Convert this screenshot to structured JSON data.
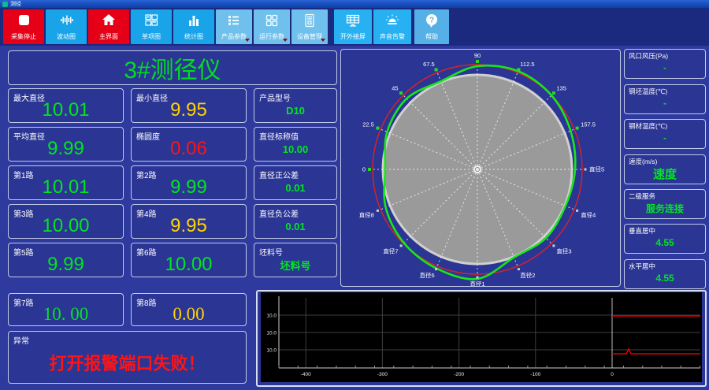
{
  "window": {
    "title": "测径"
  },
  "colors": {
    "value_green": "#00e61e",
    "value_yellow": "#ffd400",
    "value_red": "#ff1414",
    "button_red": "#e60017",
    "button_cyan": "#19a3e8",
    "button_light": "#6fc0ec",
    "tolerance_circle": "#dd2222",
    "profile_curve": "#19e619"
  },
  "toolbar": {
    "buttons": [
      {
        "label": "采集停止",
        "icon": "stop-icon",
        "style": "red",
        "dropdown": false
      },
      {
        "label": "波动图",
        "icon": "waveform-icon",
        "style": "cyan",
        "dropdown": false
      },
      {
        "label": "主界面",
        "icon": "home-icon",
        "style": "red",
        "dropdown": false
      },
      {
        "label": "单项图",
        "icon": "multi-chart-icon",
        "style": "cyan",
        "dropdown": false
      },
      {
        "label": "统计图",
        "icon": "bar-chart-icon",
        "style": "cyan",
        "dropdown": false
      },
      {
        "label": "产品参数",
        "icon": "product-params-icon",
        "style": "light",
        "dropdown": true
      },
      {
        "label": "运行参数",
        "icon": "run-params-icon",
        "style": "light",
        "dropdown": true
      },
      {
        "label": "设备管理",
        "icon": "device-manage-icon",
        "style": "light",
        "dropdown": true
      },
      {
        "label": "开外接屏",
        "icon": "external-screen-icon",
        "style": "bright",
        "dropdown": false
      },
      {
        "label": "声音告警",
        "icon": "sound-alarm-icon",
        "style": "bright",
        "dropdown": false
      },
      {
        "label": "帮助",
        "icon": "help-icon",
        "style": "help",
        "dropdown": false
      }
    ]
  },
  "left": {
    "title": "3#测径仪",
    "rows": [
      [
        {
          "label": "最大直径",
          "value": "10.01",
          "color": "green"
        },
        {
          "label": "最小直径",
          "value": "9.95",
          "color": "yellow"
        },
        {
          "label": "产品型号",
          "value": "D10",
          "color": "green"
        }
      ],
      [
        {
          "label": "平均直径",
          "value": "9.99",
          "color": "green"
        },
        {
          "label": "椭圆度",
          "value": "0.06",
          "color": "red"
        },
        {
          "label": "直径标称值",
          "value": "10.00",
          "color": "green"
        }
      ],
      [
        {
          "label": "第1路",
          "value": "10.01",
          "color": "green"
        },
        {
          "label": "第2路",
          "value": "9.99",
          "color": "green"
        },
        {
          "label": "直径正公差",
          "value": "0.01",
          "color": "green"
        }
      ],
      [
        {
          "label": "第3路",
          "value": "10.00",
          "color": "green"
        },
        {
          "label": "第4路",
          "value": "9.95",
          "color": "yellow"
        },
        {
          "label": "直径负公差",
          "value": "0.01",
          "color": "green"
        }
      ],
      [
        {
          "label": "第5路",
          "value": "9.99",
          "color": "green"
        },
        {
          "label": "第6路",
          "value": "10.00",
          "color": "green"
        },
        {
          "label": "坯料号",
          "value": "坯料号",
          "color": "green"
        }
      ],
      [
        {
          "label": "第7路",
          "value": "10. 00",
          "color": "green"
        },
        {
          "label": "第8路",
          "value": "0.00",
          "color": "yellow"
        }
      ]
    ],
    "alarm": {
      "label": "异常",
      "value": "打开报警端口失败！",
      "color": "red"
    }
  },
  "polar": {
    "spoke_labels": [
      {
        "angle": 180,
        "text": "0",
        "kind": "angle"
      },
      {
        "angle": 157.5,
        "text": "22.5",
        "kind": "angle"
      },
      {
        "angle": 135,
        "text": "45",
        "kind": "angle"
      },
      {
        "angle": 112.5,
        "text": "67.5",
        "kind": "angle"
      },
      {
        "angle": 90,
        "text": "90",
        "kind": "angle"
      },
      {
        "angle": 67.5,
        "text": "112.5",
        "kind": "angle"
      },
      {
        "angle": 45,
        "text": "135",
        "kind": "angle"
      },
      {
        "angle": 22.5,
        "text": "157.5",
        "kind": "angle"
      },
      {
        "angle": 0,
        "text": "直径5",
        "kind": "diameter"
      },
      {
        "angle": 337.5,
        "text": "直径4",
        "kind": "diameter"
      },
      {
        "angle": 315,
        "text": "直径3",
        "kind": "diameter"
      },
      {
        "angle": 292.5,
        "text": "直径2",
        "kind": "diameter"
      },
      {
        "angle": 270,
        "text": "直径1",
        "kind": "diameter"
      },
      {
        "angle": 247.5,
        "text": "直径6",
        "kind": "diameter"
      },
      {
        "angle": 225,
        "text": "直径7",
        "kind": "diameter"
      },
      {
        "angle": 202.5,
        "text": "直径8",
        "kind": "diameter"
      }
    ],
    "profile": [
      [
        0,
        124
      ],
      [
        22.5,
        128
      ],
      [
        45,
        133
      ],
      [
        67.5,
        135
      ],
      [
        90,
        131
      ],
      [
        112.5,
        121
      ],
      [
        135,
        127
      ],
      [
        157.5,
        124
      ],
      [
        180,
        117
      ],
      [
        202.5,
        126
      ],
      [
        225,
        132
      ],
      [
        247.5,
        136
      ],
      [
        270,
        139
      ],
      [
        292.5,
        121
      ],
      [
        315,
        123
      ],
      [
        337.5,
        121
      ]
    ],
    "gray_radius": 120,
    "tolerance_radius": 133
  },
  "sidebar": {
    "panels": [
      {
        "label": "风口风压(Pa)",
        "value": "-",
        "big": false
      },
      {
        "label": "钢坯温度(℃)",
        "value": "-",
        "big": false
      },
      {
        "label": "钢材温度(℃)",
        "value": "-",
        "big": false
      },
      {
        "label": "速度(m/s)",
        "value": "速度",
        "big": true
      },
      {
        "label": "二级服务",
        "value": "服务连接",
        "big": false
      },
      {
        "label": "垂直居中",
        "value": "4.55",
        "big": false
      },
      {
        "label": "水平居中",
        "value": "4.55",
        "big": false
      }
    ]
  },
  "trend": {
    "y_axis_labels": [
      "10.0",
      "10.0",
      "10.0"
    ],
    "x_tick_labels": [
      "-400",
      "-300",
      "-200",
      "-100",
      "0"
    ],
    "red_lines": [
      {
        "start_tick": "0",
        "level": 1,
        "spike": false
      },
      {
        "start_tick": "0",
        "level": 3,
        "spike": true
      }
    ]
  }
}
